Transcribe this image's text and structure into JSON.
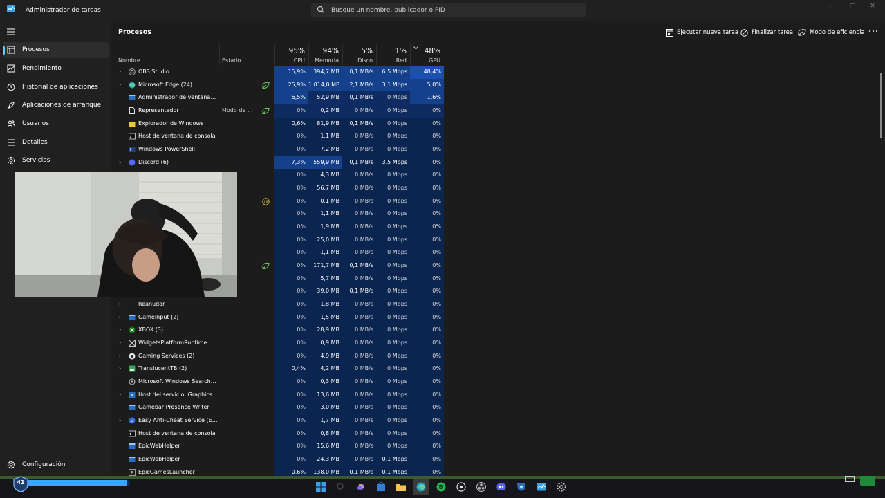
{
  "titlebar": {
    "title": "Administrador de tareas",
    "search_placeholder": "Busque un nombre, publicador o PID"
  },
  "sidebar": {
    "items": [
      {
        "label": "Procesos",
        "icon": "processes-icon",
        "active": true
      },
      {
        "label": "Rendimiento",
        "icon": "performance-icon",
        "active": false
      },
      {
        "label": "Historial de aplicaciones",
        "icon": "history-icon",
        "active": false
      },
      {
        "label": "Aplicaciones de arranque",
        "icon": "startup-icon",
        "active": false
      },
      {
        "label": "Usuarios",
        "icon": "users-icon",
        "active": false
      },
      {
        "label": "Detalles",
        "icon": "details-icon",
        "active": false
      },
      {
        "label": "Servicios",
        "icon": "services-icon",
        "active": false
      }
    ],
    "settings_label": "Configuración"
  },
  "toolbar": {
    "title": "Procesos",
    "run_task": "Ejecutar nueva tarea",
    "end_task": "Finalizar tarea",
    "efficiency_mode": "Modo de eficiencia"
  },
  "columns": {
    "name": "Nombre",
    "status": "Estado",
    "cpu": {
      "pct": "95%",
      "label": "CPU"
    },
    "memory": {
      "pct": "94%",
      "label": "Memoria"
    },
    "disk": {
      "pct": "5%",
      "label": "Disco"
    },
    "network": {
      "pct": "1%",
      "label": "Red"
    },
    "gpu": {
      "pct": "48%",
      "label": "GPU"
    }
  },
  "processes": [
    {
      "name": "OBS Studio",
      "expandable": true,
      "icon": "obs-icon",
      "status": "",
      "status_icon": "",
      "cpu": "15,9%",
      "mem": "394,7 MB",
      "disk": "0,1 MB/s",
      "net": "6,5 Mbps",
      "gpu": "48,4%",
      "heat": {
        "cpu": 3,
        "mem": 3,
        "disk": 3,
        "net": 3,
        "gpu": 4
      }
    },
    {
      "name": "Microsoft Edge (24)",
      "expandable": true,
      "icon": "edge-icon",
      "status": "",
      "status_icon": "efficiency-leaf-icon",
      "cpu": "25,9%",
      "mem": "1.014,0 MB",
      "disk": "2,1 MB/s",
      "net": "3,1 Mbps",
      "gpu": "5,0%",
      "heat": {
        "cpu": 3,
        "mem": 3,
        "disk": 3,
        "net": 3,
        "gpu": 3
      }
    },
    {
      "name": "Administrador de ventanas de...",
      "expandable": false,
      "icon": "window-icon",
      "status": "",
      "status_icon": "",
      "cpu": "6,5%",
      "mem": "52,9 MB",
      "disk": "0,1 MB/s",
      "net": "0 Mbps",
      "gpu": "1,6%",
      "heat": {
        "cpu": 3,
        "mem": 2,
        "disk": 2,
        "net": 2,
        "gpu": 3
      }
    },
    {
      "name": "Representador",
      "expandable": false,
      "icon": "file-icon",
      "status": "Modo de ...",
      "status_icon": "efficiency-leaf-icon",
      "cpu": "0%",
      "mem": "0,2 MB",
      "disk": "0 MB/s",
      "net": "0 Mbps",
      "gpu": "0%",
      "heat": {
        "cpu": 2,
        "mem": 2,
        "disk": 2,
        "net": 2,
        "gpu": 2
      }
    },
    {
      "name": "Explorador de Windows",
      "expandable": false,
      "icon": "folder-icon",
      "status": "",
      "status_icon": "",
      "cpu": "0,6%",
      "mem": "81,9 MB",
      "disk": "0,1 MB/s",
      "net": "0 Mbps",
      "gpu": "0%",
      "heat": {
        "cpu": 1,
        "mem": 1,
        "disk": 1,
        "net": 1,
        "gpu": 1
      }
    },
    {
      "name": "Host de ventana de consola",
      "expandable": false,
      "icon": "console-icon",
      "status": "",
      "status_icon": "",
      "cpu": "0%",
      "mem": "1,1 MB",
      "disk": "0 MB/s",
      "net": "0 Mbps",
      "gpu": "0%",
      "heat": {
        "cpu": 1,
        "mem": 1,
        "disk": 1,
        "net": 1,
        "gpu": 1
      }
    },
    {
      "name": "Windows PowerShell",
      "expandable": false,
      "icon": "powershell-icon",
      "status": "",
      "status_icon": "",
      "cpu": "0%",
      "mem": "7,2 MB",
      "disk": "0 MB/s",
      "net": "0 Mbps",
      "gpu": "0%",
      "heat": {
        "cpu": 1,
        "mem": 1,
        "disk": 1,
        "net": 1,
        "gpu": 1
      }
    },
    {
      "name": "Discord (6)",
      "expandable": true,
      "icon": "discord-icon",
      "status": "",
      "status_icon": "",
      "cpu": "7,3%",
      "mem": "559,9 MB",
      "disk": "0,1 MB/s",
      "net": "3,5 Mbps",
      "gpu": "0%",
      "heat": {
        "cpu": 3,
        "mem": 3,
        "disk": 1,
        "net": 1,
        "gpu": 1
      }
    },
    {
      "name": "",
      "expandable": false,
      "icon": "",
      "status": "",
      "status_icon": "",
      "cpu": "0%",
      "mem": "4,3 MB",
      "disk": "0 MB/s",
      "net": "0 Mbps",
      "gpu": "0%",
      "heat": {
        "cpu": 1,
        "mem": 1,
        "disk": 1,
        "net": 1,
        "gpu": 1
      }
    },
    {
      "name": "",
      "expandable": false,
      "icon": "",
      "status": "",
      "status_icon": "",
      "cpu": "0%",
      "mem": "56,7 MB",
      "disk": "0 MB/s",
      "net": "0 Mbps",
      "gpu": "0%",
      "heat": {
        "cpu": 1,
        "mem": 1,
        "disk": 1,
        "net": 1,
        "gpu": 1
      }
    },
    {
      "name": "",
      "expandable": false,
      "icon": "",
      "status": "",
      "status_icon": "paused-icon",
      "cpu": "0%",
      "mem": "0,1 MB",
      "disk": "0 MB/s",
      "net": "0 Mbps",
      "gpu": "0%",
      "heat": {
        "cpu": 1,
        "mem": 1,
        "disk": 1,
        "net": 1,
        "gpu": 1
      }
    },
    {
      "name": "",
      "expandable": false,
      "icon": "",
      "status": "",
      "status_icon": "",
      "cpu": "0%",
      "mem": "1,1 MB",
      "disk": "0 MB/s",
      "net": "0 Mbps",
      "gpu": "0%",
      "heat": {
        "cpu": 1,
        "mem": 1,
        "disk": 1,
        "net": 1,
        "gpu": 1
      }
    },
    {
      "name": "",
      "expandable": false,
      "icon": "",
      "status": "",
      "status_icon": "",
      "cpu": "0%",
      "mem": "1,9 MB",
      "disk": "0 MB/s",
      "net": "0 Mbps",
      "gpu": "0%",
      "heat": {
        "cpu": 1,
        "mem": 1,
        "disk": 1,
        "net": 1,
        "gpu": 1
      }
    },
    {
      "name": "",
      "expandable": false,
      "icon": "",
      "status": "",
      "status_icon": "",
      "cpu": "0%",
      "mem": "25,0 MB",
      "disk": "0 MB/s",
      "net": "0 Mbps",
      "gpu": "0%",
      "heat": {
        "cpu": 1,
        "mem": 1,
        "disk": 1,
        "net": 1,
        "gpu": 1
      }
    },
    {
      "name": "",
      "expandable": false,
      "icon": "",
      "status": "",
      "status_icon": "",
      "cpu": "0%",
      "mem": "1,1 MB",
      "disk": "0 MB/s",
      "net": "0 Mbps",
      "gpu": "0%",
      "heat": {
        "cpu": 1,
        "mem": 1,
        "disk": 1,
        "net": 1,
        "gpu": 1
      }
    },
    {
      "name": "",
      "expandable": false,
      "icon": "",
      "status": "",
      "status_icon": "efficiency-leaf-icon",
      "cpu": "0%",
      "mem": "171,7 MB",
      "disk": "0,1 MB/s",
      "net": "0 Mbps",
      "gpu": "0%",
      "heat": {
        "cpu": 1,
        "mem": 1,
        "disk": 1,
        "net": 1,
        "gpu": 1
      }
    },
    {
      "name": "",
      "expandable": false,
      "icon": "",
      "status": "",
      "status_icon": "",
      "cpu": "0%",
      "mem": "5,7 MB",
      "disk": "0 MB/s",
      "net": "0 Mbps",
      "gpu": "0%",
      "heat": {
        "cpu": 1,
        "mem": 1,
        "disk": 1,
        "net": 1,
        "gpu": 1
      }
    },
    {
      "name": "",
      "expandable": false,
      "icon": "",
      "status": "",
      "status_icon": "",
      "cpu": "0%",
      "mem": "39,0 MB",
      "disk": "0,1 MB/s",
      "net": "0 Mbps",
      "gpu": "0%",
      "heat": {
        "cpu": 1,
        "mem": 1,
        "disk": 1,
        "net": 1,
        "gpu": 1
      }
    },
    {
      "name": "Reanudar",
      "expandable": true,
      "icon": "",
      "status": "",
      "status_icon": "",
      "cpu": "0%",
      "mem": "1,8 MB",
      "disk": "0 MB/s",
      "net": "0 Mbps",
      "gpu": "0%",
      "heat": {
        "cpu": 1,
        "mem": 1,
        "disk": 1,
        "net": 1,
        "gpu": 1
      }
    },
    {
      "name": "GameInput (2)",
      "expandable": true,
      "icon": "window-icon",
      "status": "",
      "status_icon": "",
      "cpu": "0%",
      "mem": "1,5 MB",
      "disk": "0 MB/s",
      "net": "0 Mbps",
      "gpu": "0%",
      "heat": {
        "cpu": 1,
        "mem": 1,
        "disk": 1,
        "net": 1,
        "gpu": 1
      }
    },
    {
      "name": "XBOX (3)",
      "expandable": true,
      "icon": "xbox-icon",
      "status": "",
      "status_icon": "",
      "cpu": "0%",
      "mem": "28,9 MB",
      "disk": "0 MB/s",
      "net": "0 Mbps",
      "gpu": "0%",
      "heat": {
        "cpu": 1,
        "mem": 1,
        "disk": 1,
        "net": 1,
        "gpu": 1
      }
    },
    {
      "name": "WidgetsPlatformRuntime",
      "expandable": true,
      "icon": "widgets-icon",
      "status": "",
      "status_icon": "",
      "cpu": "0%",
      "mem": "0,9 MB",
      "disk": "0 MB/s",
      "net": "0 Mbps",
      "gpu": "0%",
      "heat": {
        "cpu": 1,
        "mem": 1,
        "disk": 1,
        "net": 1,
        "gpu": 1
      }
    },
    {
      "name": "Gaming Services (2)",
      "expandable": true,
      "icon": "gaming-services-icon",
      "status": "",
      "status_icon": "",
      "cpu": "0%",
      "mem": "4,9 MB",
      "disk": "0 MB/s",
      "net": "0 Mbps",
      "gpu": "0%",
      "heat": {
        "cpu": 1,
        "mem": 1,
        "disk": 1,
        "net": 1,
        "gpu": 1
      }
    },
    {
      "name": "TranslucentTB (2)",
      "expandable": true,
      "icon": "translucenttb-icon",
      "status": "",
      "status_icon": "",
      "cpu": "0,4%",
      "mem": "4,2 MB",
      "disk": "0 MB/s",
      "net": "0 Mbps",
      "gpu": "0%",
      "heat": {
        "cpu": 1,
        "mem": 1,
        "disk": 1,
        "net": 1,
        "gpu": 1
      }
    },
    {
      "name": "Microsoft Windows Search Pr...",
      "expandable": false,
      "icon": "search-gear-icon",
      "status": "",
      "status_icon": "",
      "cpu": "0%",
      "mem": "0,3 MB",
      "disk": "0 MB/s",
      "net": "0 Mbps",
      "gpu": "0%",
      "heat": {
        "cpu": 1,
        "mem": 1,
        "disk": 1,
        "net": 1,
        "gpu": 1
      }
    },
    {
      "name": "Host del servicio: GraphicsPerf...",
      "expandable": true,
      "icon": "gear-icon",
      "status": "",
      "status_icon": "",
      "cpu": "0%",
      "mem": "13,6 MB",
      "disk": "0 MB/s",
      "net": "0 Mbps",
      "gpu": "0%",
      "heat": {
        "cpu": 1,
        "mem": 1,
        "disk": 1,
        "net": 1,
        "gpu": 1
      }
    },
    {
      "name": "Gamebar Presence Writer",
      "expandable": false,
      "icon": "window-icon",
      "status": "",
      "status_icon": "",
      "cpu": "0%",
      "mem": "3,0 MB",
      "disk": "0 MB/s",
      "net": "0 Mbps",
      "gpu": "0%",
      "heat": {
        "cpu": 1,
        "mem": 1,
        "disk": 1,
        "net": 1,
        "gpu": 1
      }
    },
    {
      "name": "Easy Anti-Cheat Service (EOS) ...",
      "expandable": true,
      "icon": "anticheat-icon",
      "status": "",
      "status_icon": "",
      "cpu": "0%",
      "mem": "1,7 MB",
      "disk": "0 MB/s",
      "net": "0 Mbps",
      "gpu": "0%",
      "heat": {
        "cpu": 1,
        "mem": 1,
        "disk": 1,
        "net": 1,
        "gpu": 1
      }
    },
    {
      "name": "Host de ventana de consola",
      "expandable": false,
      "icon": "console-icon",
      "status": "",
      "status_icon": "",
      "cpu": "0%",
      "mem": "0,8 MB",
      "disk": "0 MB/s",
      "net": "0 Mbps",
      "gpu": "0%",
      "heat": {
        "cpu": 1,
        "mem": 1,
        "disk": 1,
        "net": 1,
        "gpu": 1
      }
    },
    {
      "name": "EpicWebHelper",
      "expandable": false,
      "icon": "window-icon",
      "status": "",
      "status_icon": "",
      "cpu": "0%",
      "mem": "15,6 MB",
      "disk": "0 MB/s",
      "net": "0 Mbps",
      "gpu": "0%",
      "heat": {
        "cpu": 1,
        "mem": 1,
        "disk": 1,
        "net": 1,
        "gpu": 1
      }
    },
    {
      "name": "EpicWebHelper",
      "expandable": false,
      "icon": "window-icon",
      "status": "",
      "status_icon": "",
      "cpu": "0%",
      "mem": "24,3 MB",
      "disk": "0 MB/s",
      "net": "0,1 Mbps",
      "gpu": "0%",
      "heat": {
        "cpu": 1,
        "mem": 1,
        "disk": 1,
        "net": 1,
        "gpu": 1
      }
    },
    {
      "name": "EpicGamesLauncher",
      "expandable": false,
      "icon": "epic-icon",
      "status": "",
      "status_icon": "",
      "cpu": "0,6%",
      "mem": "138,0 MB",
      "disk": "0,1 MB/s",
      "net": "0,1 Mbps",
      "gpu": "0%",
      "heat": {
        "cpu": 1,
        "mem": 1,
        "disk": 1,
        "net": 1,
        "gpu": 1
      }
    }
  ],
  "overlay": {
    "level": "41",
    "xp_fraction": 0.97
  },
  "taskbar": {
    "icons": [
      "windows-start-icon",
      "taskbar-search-icon",
      "copilot-icon",
      "store-icon",
      "file-explorer-icon",
      "edge-icon",
      "spotify-icon",
      "steam-icon",
      "obs-icon",
      "discord-icon",
      "rocket-league-icon",
      "task-manager-icon",
      "settings-icon"
    ],
    "active": "edge-icon"
  },
  "colors": {
    "accent": "#60cdff",
    "heat_1": "#0b2a5c",
    "heat_2": "#10306a",
    "heat_3": "#16428f",
    "heat_4": "#1b4fb0",
    "status_leaf": "#6ccb5f"
  }
}
